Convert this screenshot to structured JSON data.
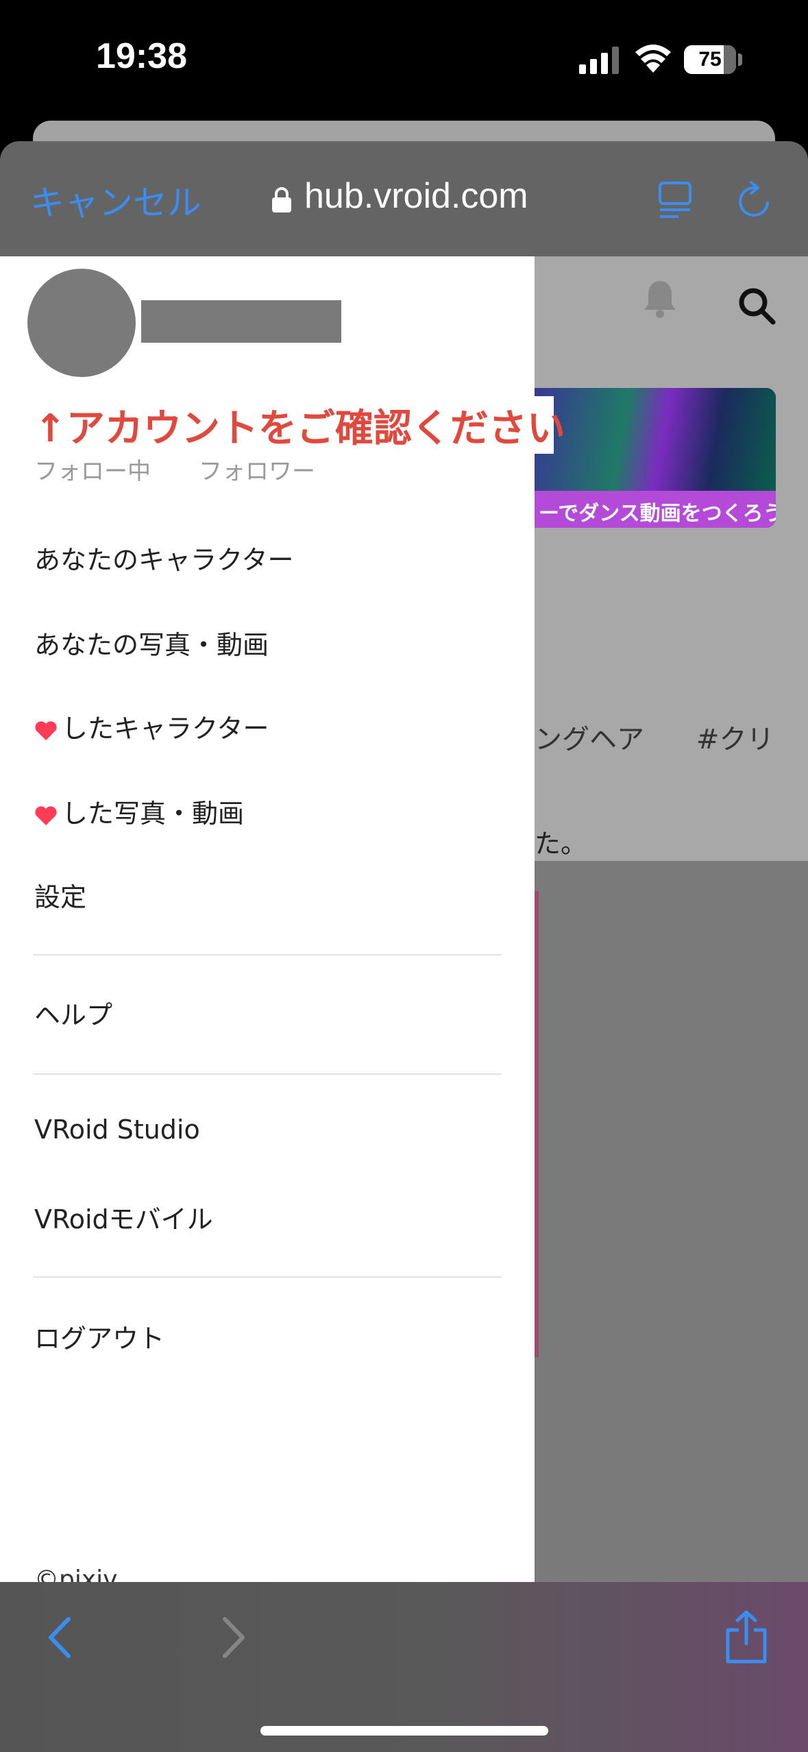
{
  "status_bar": {
    "time": "19:38",
    "battery": "75",
    "icons": [
      "signal-icon",
      "wifi-icon",
      "battery-icon"
    ]
  },
  "sheet": {
    "cancel_label": "キャンセル",
    "url": "hub.vroid.com",
    "icons": [
      "lock-icon",
      "reader-icon",
      "reload-icon"
    ]
  },
  "drawer": {
    "notice": "↑アカウントをご確認ください",
    "following_label": "フォロー中",
    "followers_label": "フォロワー",
    "menu": {
      "your_characters": "あなたのキャラクター",
      "your_photos": "あなたの写真・動画",
      "liked_characters": "したキャラクター",
      "liked_photos": "した写真・動画",
      "settings": "設定",
      "help": "ヘルプ",
      "vroid_studio": "VRoid Studio",
      "vroid_mobile": "VRoidモバイル",
      "logout": "ログアウト"
    },
    "copyright": "©pixiv"
  },
  "background_page": {
    "banner_text": "ーでダンス動画をつくろう！",
    "tag_1": "ングヘア",
    "tag_2": "#クリ",
    "text_fragment": "た。"
  },
  "colors": {
    "accent": "#3a8df1",
    "notice": "#e04a3e",
    "heart": "#ff3b55"
  }
}
